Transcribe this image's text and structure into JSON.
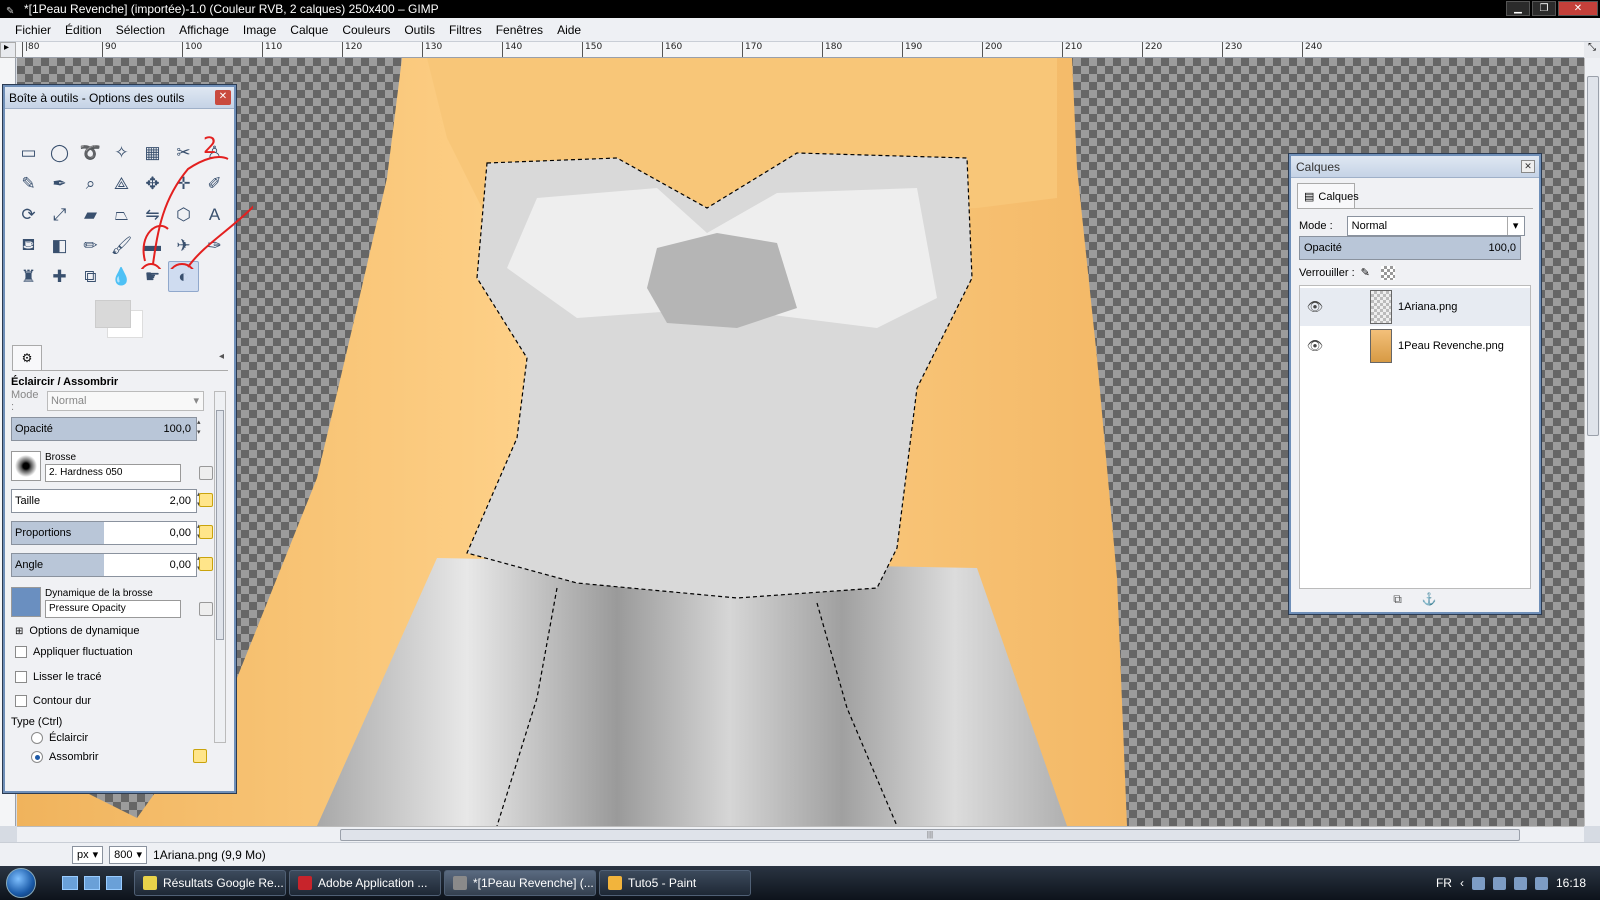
{
  "window": {
    "title": "*[1Peau Revenche] (importée)-1.0 (Couleur RVB, 2 calques) 250x400 – GIMP",
    "minimize_glyph": "▁",
    "maximize_glyph": "❐",
    "close_glyph": "✕"
  },
  "menu": [
    "Fichier",
    "Édition",
    "Sélection",
    "Affichage",
    "Image",
    "Calque",
    "Couleurs",
    "Outils",
    "Filtres",
    "Fenêtres",
    "Aide"
  ],
  "ruler_ticks": [
    "90",
    "100",
    "110",
    "120",
    "130",
    "140",
    "150",
    "160",
    "170",
    "180",
    "190",
    "200",
    "210",
    "220",
    "230",
    "240"
  ],
  "ruler_first_tick": "|80",
  "toolbox": {
    "title": "Boîte à outils - Options des outils",
    "close_glyph": "✕",
    "tools": [
      {
        "name": "rect-select-tool",
        "glyph": "▭"
      },
      {
        "name": "ellipse-select-tool",
        "glyph": "◯"
      },
      {
        "name": "free-select-tool",
        "glyph": "➰"
      },
      {
        "name": "fuzzy-select-tool",
        "glyph": "✧"
      },
      {
        "name": "color-select-tool",
        "glyph": "▦"
      },
      {
        "name": "scissors-tool",
        "glyph": "✂"
      },
      {
        "name": "foreground-select-tool",
        "glyph": "♙"
      },
      {
        "name": "paths-tool",
        "glyph": "✎"
      },
      {
        "name": "color-picker-tool",
        "glyph": "✒"
      },
      {
        "name": "zoom-tool",
        "glyph": "⌕"
      },
      {
        "name": "measure-tool",
        "glyph": "⟁"
      },
      {
        "name": "move-tool",
        "glyph": "✥"
      },
      {
        "name": "align-tool",
        "glyph": "✛"
      },
      {
        "name": "crop-tool",
        "glyph": "✐"
      },
      {
        "name": "rotate-tool",
        "glyph": "⟳"
      },
      {
        "name": "scale-tool",
        "glyph": "⤢"
      },
      {
        "name": "shear-tool",
        "glyph": "▰"
      },
      {
        "name": "perspective-tool",
        "glyph": "⏢"
      },
      {
        "name": "flip-tool",
        "glyph": "⇋"
      },
      {
        "name": "cage-tool",
        "glyph": "⬡"
      },
      {
        "name": "text-tool",
        "glyph": "A"
      },
      {
        "name": "bucket-fill-tool",
        "glyph": "⛾"
      },
      {
        "name": "blend-tool",
        "glyph": "◧"
      },
      {
        "name": "pencil-tool",
        "glyph": "✏"
      },
      {
        "name": "paintbrush-tool",
        "glyph": "🖌"
      },
      {
        "name": "eraser-tool",
        "glyph": "▬"
      },
      {
        "name": "airbrush-tool",
        "glyph": "✈"
      },
      {
        "name": "ink-tool",
        "glyph": "✑"
      },
      {
        "name": "clone-tool",
        "glyph": "♜"
      },
      {
        "name": "heal-tool",
        "glyph": "✚"
      },
      {
        "name": "perspective-clone-tool",
        "glyph": "⧉"
      },
      {
        "name": "blur-tool",
        "glyph": "💧"
      },
      {
        "name": "smudge-tool",
        "glyph": "☛"
      },
      {
        "name": "dodge-burn-tool",
        "glyph": "◐"
      }
    ],
    "options": {
      "tool_name": "Éclaircir / Assombrir",
      "mode_label": "Mode :",
      "mode_value": "Normal",
      "opacity_label": "Opacité",
      "opacity_value": "100,0",
      "opacity": 1.0,
      "brush_label": "Brosse",
      "brush_value": "2. Hardness 050",
      "size_label": "Taille",
      "size_value": "2,00",
      "size": 0.95,
      "aspect_label": "Proportions",
      "aspect_value": "0,00",
      "aspect": 0.5,
      "angle_label": "Angle",
      "angle_value": "0,00",
      "angle": 0.5,
      "dynamics_label": "Dynamique de la brosse",
      "dynamics_value": "Pressure Opacity",
      "dynamics_options_label": "Options de dynamique",
      "jitter_label": "Appliquer fluctuation",
      "smooth_label": "Lisser le tracé",
      "hard_edge_label": "Contour dur",
      "type_label": "Type (Ctrl)",
      "dodge_label": "Éclaircir",
      "burn_label": "Assombrir"
    },
    "annotations": [
      "1",
      "2"
    ],
    "annotation_color": "#e3201f"
  },
  "layers": {
    "title": "Calques",
    "tab_label": "Calques",
    "mode_label": "Mode :",
    "mode_value": "Normal",
    "opacity_label": "Opacité",
    "opacity_value": "100,0",
    "lock_label": "Verrouiller :",
    "items": [
      {
        "name": "1Ariana.png",
        "visible": "👁"
      },
      {
        "name": "1Peau Revenche.png",
        "visible": "👁"
      }
    ]
  },
  "status": {
    "unit": "px",
    "zoom": "800",
    "info": "1Ariana.png (9,9 Mo)"
  },
  "taskbar": {
    "items": [
      {
        "label": "Résultats Google Re...",
        "color": "#e8d24a"
      },
      {
        "label": "Adobe Application ...",
        "color": "#c8242b"
      },
      {
        "label": "*[1Peau Revenche] (...",
        "color": "#8a8a8a"
      },
      {
        "label": "Tuto5 - Paint",
        "color": "#f2b43c"
      }
    ],
    "language": "FR",
    "clock": "16:18"
  }
}
